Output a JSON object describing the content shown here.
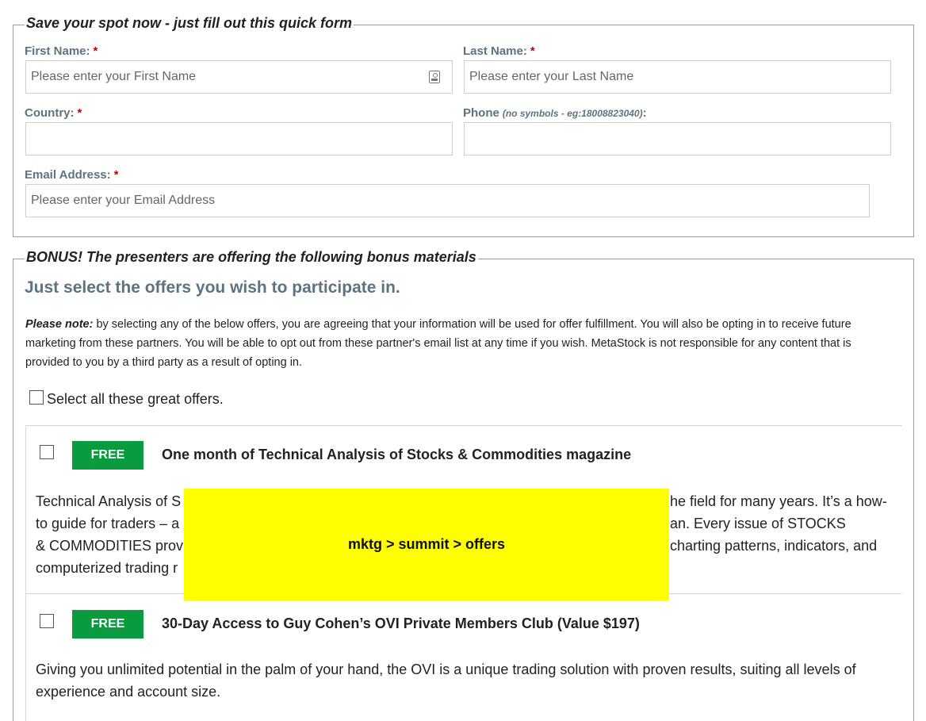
{
  "form": {
    "legend": "Save your spot now - just fill out this quick form",
    "first_name": {
      "label": "First Name:",
      "required": "*",
      "placeholder": "Please enter your First Name"
    },
    "last_name": {
      "label": "Last Name:",
      "required": "*",
      "placeholder": "Please enter your Last Name"
    },
    "country": {
      "label": "Country:",
      "required": "*",
      "placeholder": ""
    },
    "phone": {
      "label": "Phone",
      "hint": "(no symbols - eg:18008823040)",
      "suffix": ":",
      "placeholder": ""
    },
    "email": {
      "label": "Email Address:",
      "required": "*",
      "placeholder": "Please enter your Email Address"
    }
  },
  "bonus": {
    "legend": "BONUS! The presenters are offering the following bonus materials",
    "subheading": "Just select the offers you wish to participate in.",
    "note_label": "Please note:",
    "note_text": " by selecting any of the below offers, you are agreeing that your information will be used for offer fulfillment. You will also be opting in to receive future marketing from these partners. You will be able to opt out from these partner's email list at any time if you wish. MetaStock is not responsible for any content that is provided to you by a third party as a result of opting in.",
    "select_all_label": "Select all these great offers.",
    "offers": [
      {
        "badge": "FREE",
        "title": "One month of Technical Analysis of Stocks & Commodities magazine",
        "description_lines": [
          "Technical Analysis of S",
          "to guide for traders – a",
          "& COMMODITIES prov",
          "computerized trading r"
        ],
        "description_lines_right": [
          "he field for many years. It’s a how-",
          "an. Every issue of STOCKS",
          "charting patterns, indicators, and"
        ]
      },
      {
        "badge": "FREE",
        "title": "30-Day Access to Guy Cohen’s OVI Private Members Club (Value $197)",
        "description": "Giving you unlimited potential in the palm of your hand, the OVI is a unique trading solution with proven results, suiting all levels of experience and account size."
      }
    ]
  },
  "overlay": {
    "text": "mktg > summit > offers",
    "color": "#ffff00"
  },
  "colors": {
    "label": "#5c7482",
    "required": "#cc0000",
    "badge": "#0a9b3e"
  }
}
